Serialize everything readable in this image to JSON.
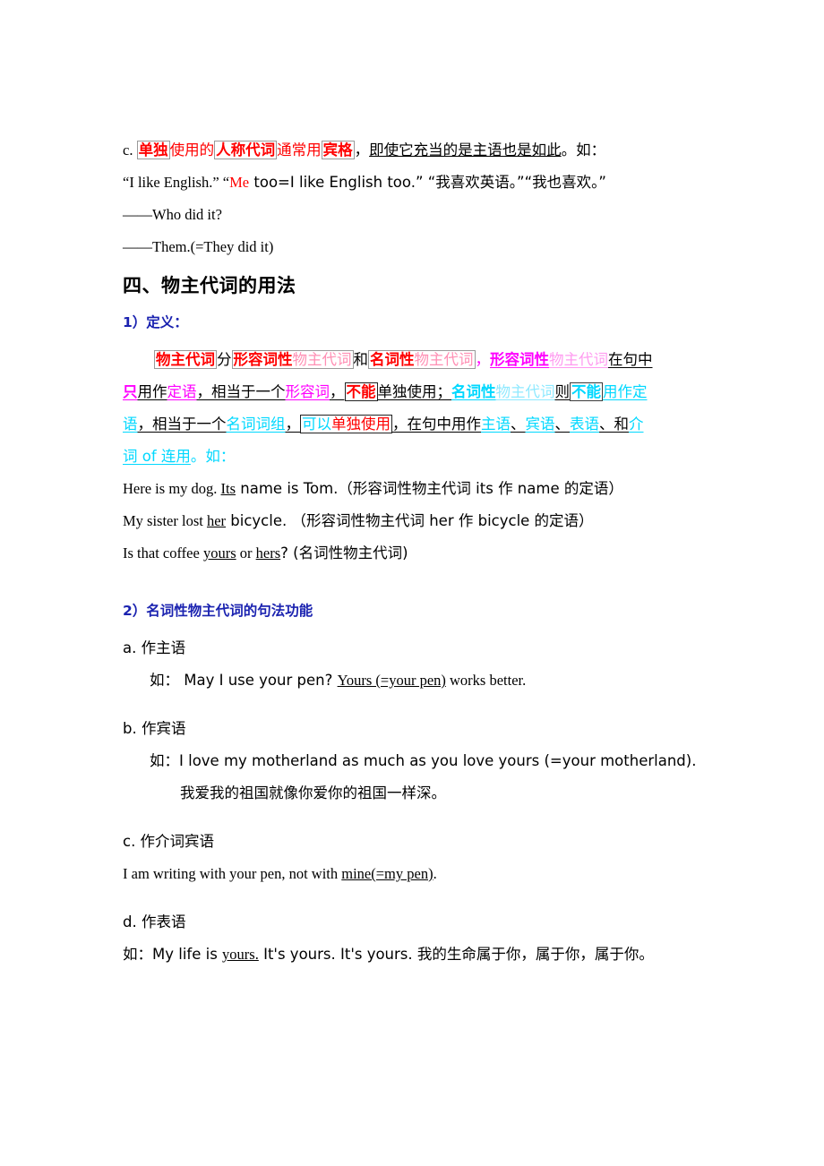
{
  "document": {
    "section_c": {
      "marker": "c.",
      "box1": "单独",
      "t1": "使用的",
      "box2": "人称代词",
      "t2": "通常用",
      "box3": "宾格",
      "t3": "，",
      "underlined": "即使它充当的是主语也是如此",
      "t4": "。如：",
      "example_line": {
        "p1": "“I like English.” “",
        "highlight": "Me",
        "p2": " too=I like English too.” “我喜欢英语。”“我也喜欢。”"
      },
      "qa_line1": "——Who did it?",
      "qa_line2": "——Them.(=They did it)"
    },
    "heading_four": "四、物主代词的用法",
    "subheading_1": "1）定义：",
    "definition": {
      "l1_box_a": "物主代词",
      "l1_t1": "分",
      "l1_box_b1": "形容词性",
      "l1_box_b2": "物主代词",
      "l1_t2": "和",
      "l1_box_c1": "名词性",
      "l1_box_c2": "物主代词",
      "l1_t3": "，",
      "l1_d1": "形容词性",
      "l1_d2": "物主代词",
      "l1_t4": "在句中",
      "l2_a": "只",
      "l2_t1": "用作",
      "l2_b": "定语",
      "l2_t2": "，相当于一个",
      "l2_c": "形容词",
      "l2_t3": "，",
      "l2_box_d": "不能",
      "l2_t4": "单独使用",
      "l2_t5": "；",
      "l2_e1": "名词性",
      "l2_e2": "物主代词",
      "l2_t6": "则",
      "l2_box_f": "不能",
      "l2_g": "用作定",
      "l3_a": "语",
      "l3_t1": "，相当于一个",
      "l3_b": "名词词组",
      "l3_t2": "，",
      "l3_box_c1": "可以",
      "l3_box_c2": "单独使用",
      "l3_t3": "，在句中用作",
      "l3_d": "主语",
      "l3_t4": "、",
      "l3_e": "宾语",
      "l3_t5": "、",
      "l3_f": "表语",
      "l3_t6": "、和",
      "l3_g": "介",
      "l4_a": "词 of 连用",
      "l4_t1": "。如："
    },
    "examples": [
      {
        "pre": "Here is my dog. ",
        "underline": "Its",
        "post": " name is Tom.（形容词性物主代词 its 作 name 的定语）"
      },
      {
        "pre": "My sister lost ",
        "underline": "her",
        "post": " bicycle. （形容词性物主代词 her 作 bicycle 的定语）"
      },
      {
        "pre": "Is that coffee ",
        "underline": "yours",
        "mid": " or ",
        "underline2": "hers",
        "post": "? (名词性物主代词)"
      }
    ],
    "subheading_2": "2）名词性物主代词的句法功能",
    "items": [
      {
        "label": "a. 作主语",
        "example_prefix": "如：  May I use your pen? ",
        "example_underline": "Yours (=your pen)",
        "example_suffix": " works better.",
        "translation": ""
      },
      {
        "label": "b. 作宾语",
        "example_prefix": "如：I love my motherland as much as you love yours (=your motherland).",
        "example_underline": "",
        "example_suffix": "",
        "translation": "我爱我的祖国就像你爱你的祖国一样深。"
      },
      {
        "label": "c. 作介词宾语",
        "example_prefix": "I am writing with your pen, not with ",
        "example_underline": "mine(=my pen)",
        "example_suffix": ".",
        "translation": ""
      },
      {
        "label": "d. 作表语",
        "example_prefix": "如：My life is ",
        "example_underline": "yours.",
        "example_suffix": " It's yours. It's yours. 我的生命属于你，属于你，属于你。",
        "translation": ""
      }
    ]
  }
}
